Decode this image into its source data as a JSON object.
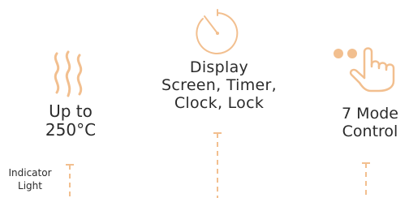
{
  "colors": {
    "accent": "#f2bf8f",
    "text": "#2b2b2b"
  },
  "features": {
    "heat": {
      "icon": "heat-waves-icon",
      "lines": [
        "Up to",
        "250°C"
      ]
    },
    "display": {
      "icon": "stopwatch-icon",
      "lines": [
        "Display",
        "Screen, Timer,",
        "Clock, Lock"
      ]
    },
    "mode": {
      "icon": "tap-hand-icon",
      "lines": [
        "7 Mode",
        "Control"
      ]
    },
    "indicator": {
      "lines": [
        "Indicator",
        "Light"
      ]
    }
  }
}
